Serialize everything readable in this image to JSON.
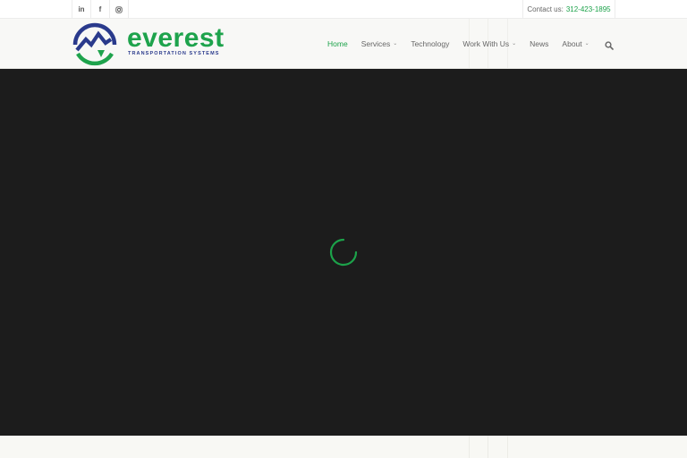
{
  "topbar": {
    "social": [
      {
        "icon": "linkedin-icon",
        "glyph": "in"
      },
      {
        "icon": "facebook-icon",
        "glyph": "f"
      },
      {
        "icon": "instagram-icon",
        "glyph": ""
      }
    ],
    "contact_label": "Contact us:",
    "contact_phone": "312-423-1895"
  },
  "header": {
    "logo_word": "everest",
    "logo_sub": "TRANSPORTATION SYSTEMS",
    "nav": [
      {
        "label": "Home",
        "active": true,
        "dropdown": false
      },
      {
        "label": "Services",
        "active": false,
        "dropdown": true
      },
      {
        "label": "Technology",
        "active": false,
        "dropdown": false
      },
      {
        "label": "Work With Us",
        "active": false,
        "dropdown": true
      },
      {
        "label": "News",
        "active": false,
        "dropdown": false
      },
      {
        "label": "About",
        "active": false,
        "dropdown": true
      }
    ]
  },
  "colors": {
    "brand_green": "#1ca24a",
    "brand_navy": "#2a3a8c",
    "hero_bg": "#1c1c1c"
  }
}
